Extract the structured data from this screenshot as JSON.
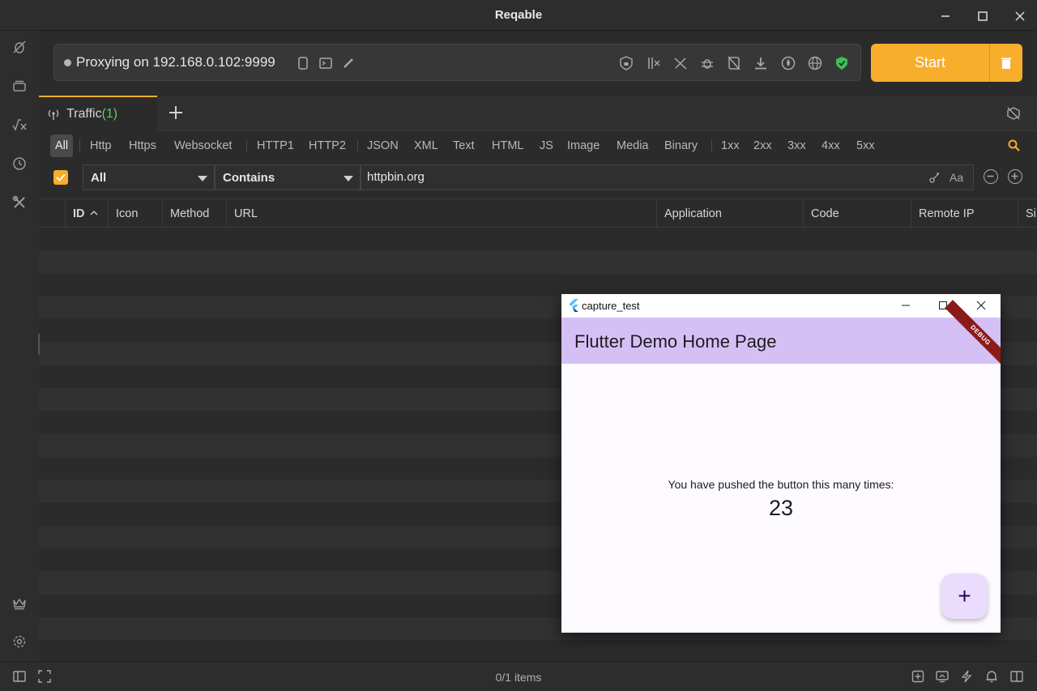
{
  "window": {
    "title": "Reqable",
    "controls": {
      "minimize": "minimize-icon",
      "maximize": "maximize-icon",
      "close": "close-icon"
    }
  },
  "sidebar": {
    "items": [
      {
        "icon": "bug-off-icon"
      },
      {
        "icon": "layers-icon"
      },
      {
        "icon": "function-icon"
      },
      {
        "icon": "history-icon"
      },
      {
        "icon": "tools-icon"
      }
    ],
    "bottom": [
      {
        "icon": "crown-icon"
      },
      {
        "icon": "gear-icon"
      }
    ]
  },
  "proxy": {
    "status_text": "Proxying on 192.168.0.102:9999",
    "start_label": "Start",
    "accent": "#f8ae2d"
  },
  "tabs": [
    {
      "label": "Traffic",
      "count": "(1)"
    }
  ],
  "filters": {
    "chips": [
      "All",
      "Http",
      "Https",
      "Websocket",
      "HTTP1",
      "HTTP2",
      "JSON",
      "XML",
      "Text",
      "HTML",
      "JS",
      "Image",
      "Media",
      "Binary",
      "1xx",
      "2xx",
      "3xx",
      "4xx",
      "5xx"
    ],
    "active_chip": "All",
    "scope_select": "All",
    "match_select": "Contains",
    "search_value": "httpbin.org",
    "case_label": "Aa"
  },
  "table": {
    "columns": [
      "ID",
      "Icon",
      "Method",
      "URL",
      "Application",
      "Code",
      "Remote IP",
      "Si"
    ]
  },
  "statusbar": {
    "items_text": "0/1 items"
  },
  "flutter_window": {
    "title": "capture_test",
    "appbar_title": "Flutter Demo Home Page",
    "debug_banner": "DEBUG",
    "counter_label": "You have pushed the button this many times:",
    "counter_value": "23",
    "fab_label": "+"
  }
}
